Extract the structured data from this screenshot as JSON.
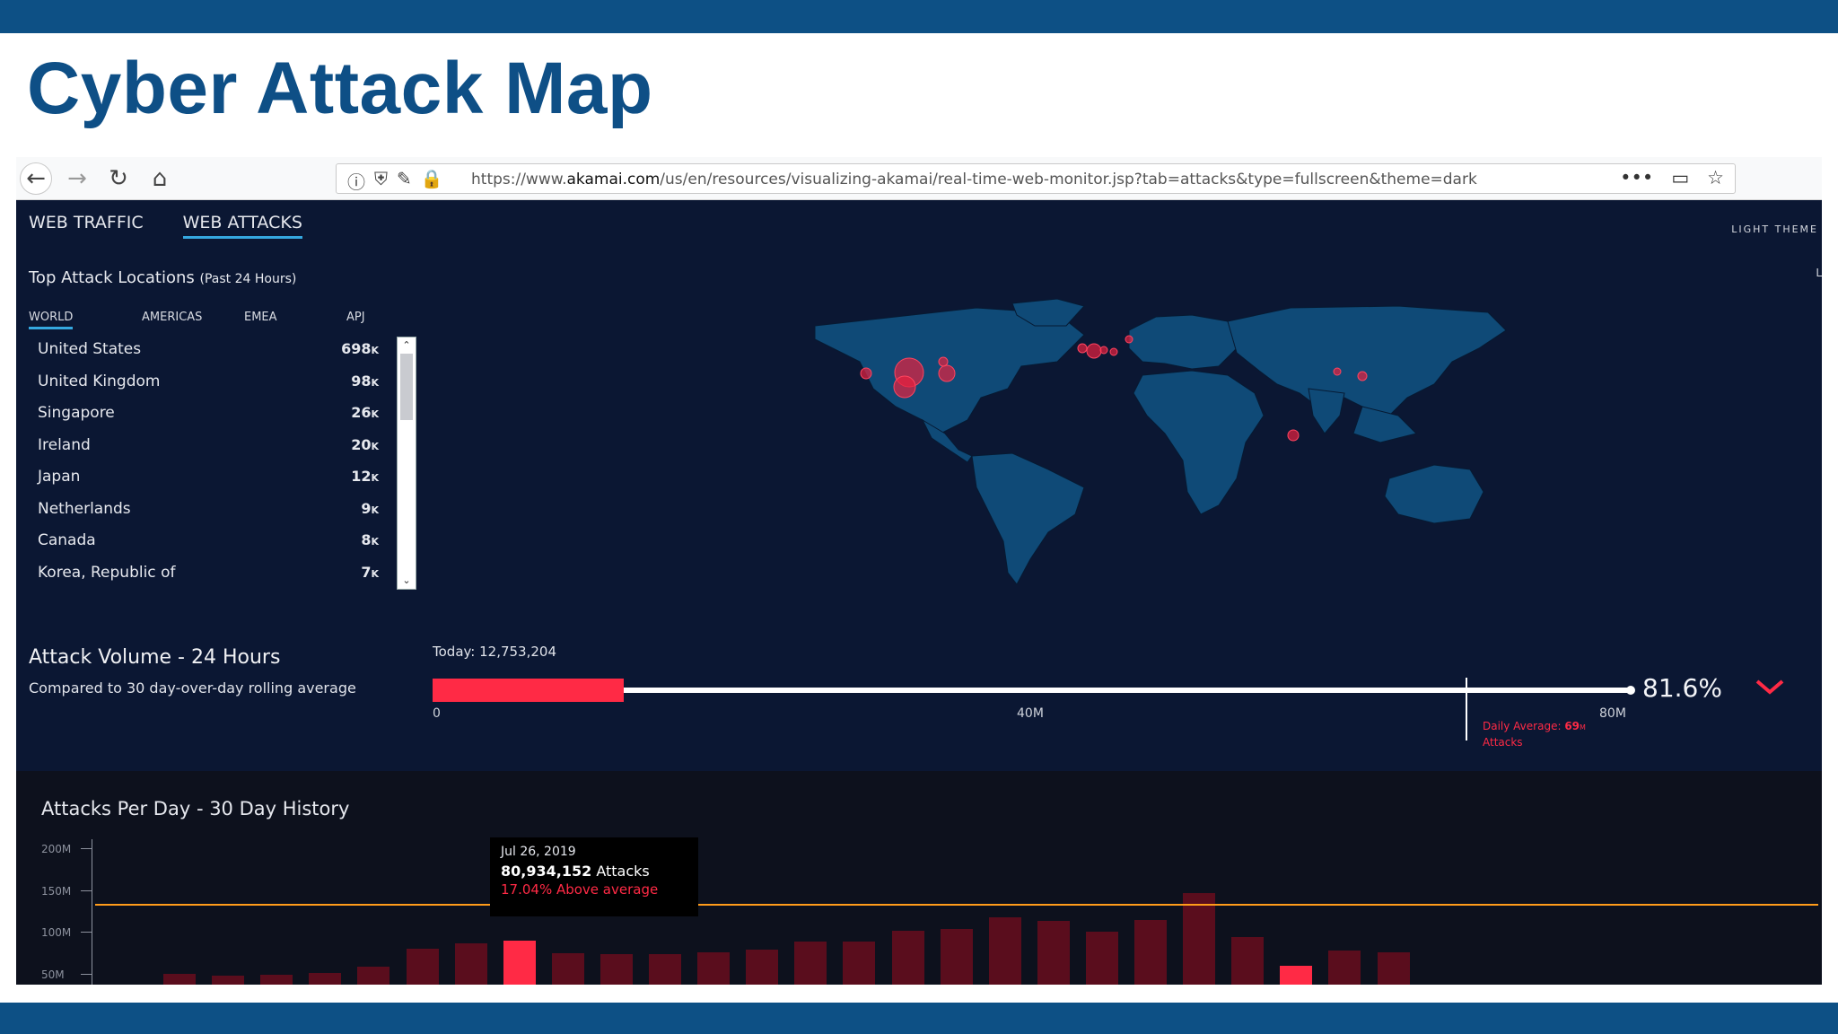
{
  "slide": {
    "title": "Cyber Attack Map"
  },
  "browser": {
    "url_prefix": "https://www.",
    "url_domain": "akamai.com",
    "url_rest": "/us/en/resources/visualizing-akamai/real-time-web-monitor.jsp?tab=attacks&type=fullscreen&theme=dark",
    "menu_label": "•••"
  },
  "app": {
    "tabs": [
      "WEB TRAFFIC",
      "WEB ATTACKS"
    ],
    "active_tab": "WEB ATTACKS",
    "theme_toggle": "LIGHT THEME",
    "edge_mark": "L",
    "top_locations": {
      "title": "Top Attack Locations",
      "subtitle": "(Past 24 Hours)",
      "regions": [
        "WORLD",
        "AMERICAS",
        "EMEA",
        "APJ"
      ],
      "active_region": "WORLD",
      "items": [
        {
          "name": "United States",
          "value": "698",
          "unit": "K"
        },
        {
          "name": "United Kingdom",
          "value": "98",
          "unit": "K"
        },
        {
          "name": "Singapore",
          "value": "26",
          "unit": "K"
        },
        {
          "name": "Ireland",
          "value": "20",
          "unit": "K"
        },
        {
          "name": "Japan",
          "value": "12",
          "unit": "K"
        },
        {
          "name": "Netherlands",
          "value": "9",
          "unit": "K"
        },
        {
          "name": "Canada",
          "value": "8",
          "unit": "K"
        },
        {
          "name": "Korea, Republic of",
          "value": "7",
          "unit": "K"
        }
      ]
    },
    "volume": {
      "title": "Attack Volume - 24 Hours",
      "subtitle": "Compared to 30 day-over-day rolling average",
      "today_label": "Today: 12,753,204",
      "today_value": 12753204,
      "scale_max": 80000000,
      "daily_average_value": 69000000,
      "ticks": [
        "0",
        "40M",
        "80M"
      ],
      "daily_avg_label": "Daily Average:",
      "daily_avg_value": "69",
      "daily_avg_unit": "M",
      "daily_avg_suffix": "Attacks",
      "percent": "81.6%",
      "trend": "down",
      "accent_color": "#ff2a45"
    },
    "history": {
      "title": "Attacks Per Day - 30 Day History",
      "y_labels": [
        "200M",
        "150M",
        "100M",
        "50M"
      ],
      "tooltip": {
        "date": "Jul 26, 2019",
        "value": "80,934,152",
        "value_suffix": "Attacks",
        "pct": "17.04% Above average"
      }
    }
  },
  "chart_data": {
    "type": "bar",
    "title": "Attacks Per Day - 30 Day History",
    "ylim": [
      0,
      200000000
    ],
    "y_unit": "attacks",
    "average_line": 69000000,
    "highlight_indices": [
      7,
      23
    ],
    "values": [
      44000000,
      42000000,
      43000000,
      45000000,
      53000000,
      76000000,
      83000000,
      86000000,
      70000000,
      69000000,
      69000000,
      72000000,
      75000000,
      85000000,
      85000000,
      99000000,
      102000000,
      117000000,
      112000000,
      98000000,
      113000000,
      148000000,
      91000000,
      54000000,
      74000000,
      72000000
    ]
  }
}
